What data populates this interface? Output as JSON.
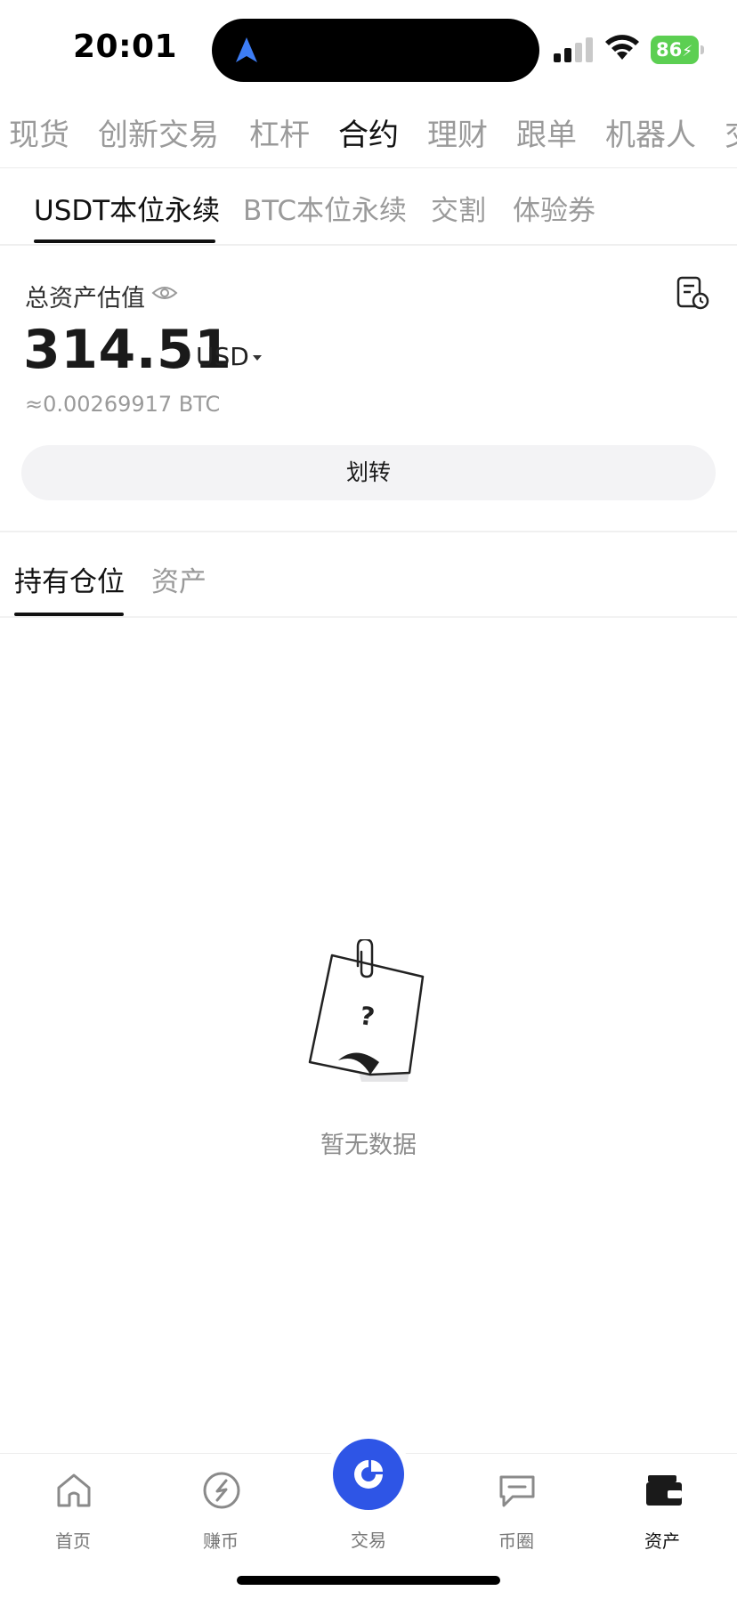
{
  "status_bar": {
    "time": "20:01",
    "battery": "86"
  },
  "top_nav": {
    "items": [
      "现货",
      "创新交易",
      "杠杆",
      "合约",
      "理财",
      "跟单",
      "机器人",
      "交"
    ],
    "active": "合约"
  },
  "sub_tabs": {
    "items": [
      "USDT本位永续",
      "BTC本位永续",
      "交割",
      "体验券"
    ],
    "active": "USDT本位永续"
  },
  "assets": {
    "label": "总资产估值",
    "value": "314.51",
    "currency": "USD",
    "btc_equivalent": "≈0.00269917 BTC",
    "transfer_label": "划转"
  },
  "position_tabs": {
    "items": [
      "持有仓位",
      "资产"
    ],
    "active": "持有仓位"
  },
  "empty_state": {
    "text": "暂无数据"
  },
  "bottom_nav": {
    "items": [
      {
        "label": "首页",
        "icon": "home-icon"
      },
      {
        "label": "赚币",
        "icon": "earn-icon"
      },
      {
        "label": "交易",
        "icon": "trade-icon"
      },
      {
        "label": "币圈",
        "icon": "chat-icon"
      },
      {
        "label": "资产",
        "icon": "wallet-icon"
      }
    ],
    "active": "资产"
  },
  "colors": {
    "accent": "#2e55e6",
    "battery": "#5ccf52",
    "muted_text": "#9a9a9a"
  }
}
